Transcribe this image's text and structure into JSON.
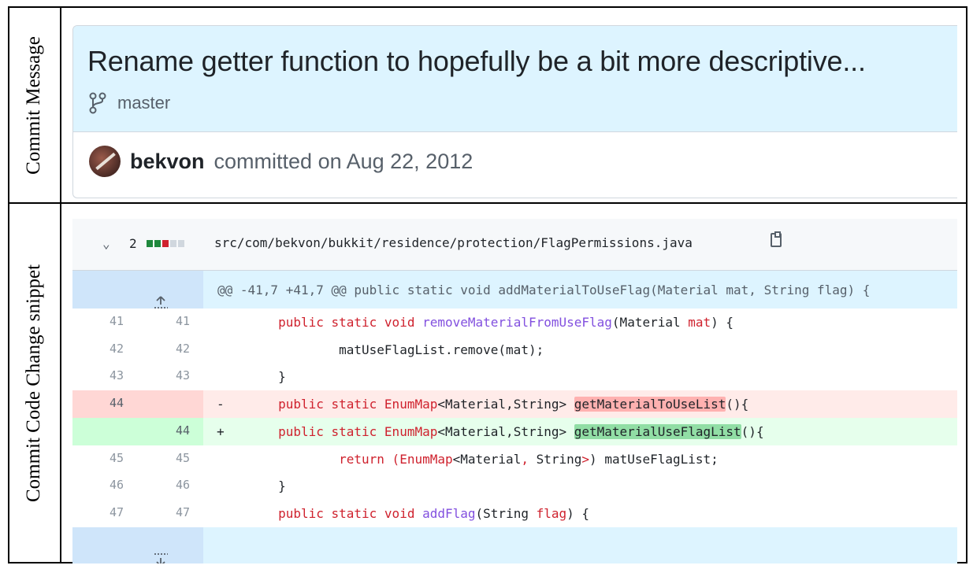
{
  "labels": {
    "commit_message": "Commit Message",
    "code_change": "Commit Code Change snippet"
  },
  "commit": {
    "title": "Rename getter function to hopefully be a bit more descriptive...",
    "branch": "master",
    "author": "bekvon",
    "committed_text": "committed on Aug 22, 2012"
  },
  "diff": {
    "changes_count": "2",
    "file_path": "src/com/bekvon/bukkit/residence/protection/FlagPermissions.java",
    "hunk_header": "@@ -41,7 +41,7 @@ public static void addMaterialToUseFlag(Material mat, String flag) {",
    "stat_colors": [
      "#1f883d",
      "#1f883d",
      "#cf222e",
      "#d0d7de",
      "#d0d7de"
    ],
    "lines": [
      {
        "old": "41",
        "new": "41",
        "type": "ctx"
      },
      {
        "old": "42",
        "new": "42",
        "type": "ctx"
      },
      {
        "old": "43",
        "new": "43",
        "type": "ctx"
      },
      {
        "old": "44",
        "new": "",
        "type": "del",
        "sign": "-"
      },
      {
        "old": "",
        "new": "44",
        "type": "add",
        "sign": "+"
      },
      {
        "old": "45",
        "new": "45",
        "type": "ctx"
      },
      {
        "old": "46",
        "new": "46",
        "type": "ctx"
      },
      {
        "old": "47",
        "new": "47",
        "type": "ctx"
      }
    ],
    "code": {
      "l1_a": "public static void ",
      "l1_fn": "removeMaterialFromUseFlag",
      "l1_b": "(Material ",
      "l1_c": "mat",
      "l1_d": ") {",
      "l2": "matUseFlagList.remove(mat);",
      "l3": "}",
      "l4_a": "public static EnumMap",
      "l4_b": "<Material,String> ",
      "l4_hl": "getMaterialToUseList",
      "l4_c": "(){",
      "l5_a": "public static EnumMap",
      "l5_b": "<Material,String> ",
      "l5_hl": "getMaterialUseFlagList",
      "l5_c": "(){",
      "l6_a": "return (",
      "l6_b": "EnumMap",
      "l6_c": "<Material",
      "l6_d": ",",
      "l6_e": " String",
      "l6_f": ">",
      "l6_g": ") matUseFlagList;",
      "l7": "}",
      "l8_a": "public static void ",
      "l8_fn": "addFlag",
      "l8_b": "(String ",
      "l8_c": "flag",
      "l8_d": ") {"
    },
    "colors": {
      "del_row": "#ffebe9",
      "del_gutter": "#ffd7d5",
      "add_row": "#e6ffec",
      "add_gutter": "#ccffd8"
    }
  }
}
